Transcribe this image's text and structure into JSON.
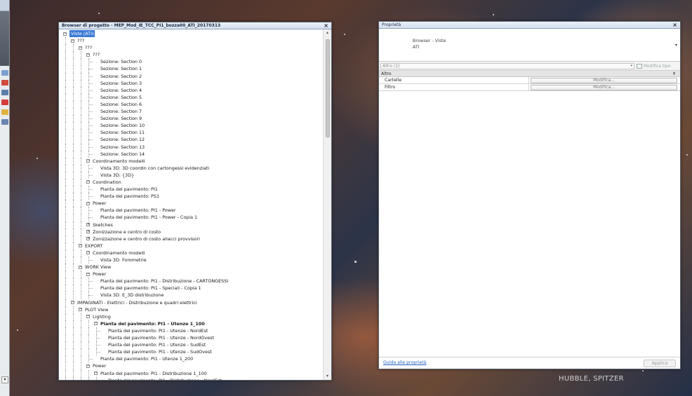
{
  "browser": {
    "title": "Browser di progetto - MEP_Mod_IE_TCC_PI1_bozza00_ATI_20170313",
    "close": "×",
    "tree": [
      {
        "level": 0,
        "exp": "−",
        "text": "Viste (ATI)",
        "selected": true
      },
      {
        "level": 1,
        "exp": "−",
        "text": "???"
      },
      {
        "level": 2,
        "exp": "−",
        "text": "???"
      },
      {
        "level": 3,
        "exp": "−",
        "text": "???"
      },
      {
        "level": 4,
        "text": "Sezione: Section 0"
      },
      {
        "level": 4,
        "text": "Sezione: Section 1"
      },
      {
        "level": 4,
        "text": "Sezione: Section 2"
      },
      {
        "level": 4,
        "text": "Sezione: Section 3"
      },
      {
        "level": 4,
        "text": "Sezione: Section 4"
      },
      {
        "level": 4,
        "text": "Sezione: Section 5"
      },
      {
        "level": 4,
        "text": "Sezione: Section 6"
      },
      {
        "level": 4,
        "text": "Sezione: Section 7"
      },
      {
        "level": 4,
        "text": "Sezione: Section 9"
      },
      {
        "level": 4,
        "text": "Sezione: Section 10"
      },
      {
        "level": 4,
        "text": "Sezione: Section 11"
      },
      {
        "level": 4,
        "text": "Sezione: Section 12"
      },
      {
        "level": 4,
        "text": "Sezione: Section 13"
      },
      {
        "level": 4,
        "text": "Sezione: Section 14"
      },
      {
        "level": 3,
        "exp": "−",
        "text": "Coordinamento modelli"
      },
      {
        "level": 4,
        "text": "Vista 3D: 3D coordin con cartongessi evidenziati"
      },
      {
        "level": 4,
        "text": "Vista 3D: {3D}"
      },
      {
        "level": 3,
        "exp": "−",
        "text": "Coordination"
      },
      {
        "level": 4,
        "text": "Pianta del pavimento: PI1"
      },
      {
        "level": 4,
        "text": "Pianta del pavimento: PS1"
      },
      {
        "level": 3,
        "exp": "−",
        "text": "Power"
      },
      {
        "level": 4,
        "text": "Pianta del pavimento: PI1 - Power"
      },
      {
        "level": 4,
        "text": "Pianta del pavimento: PI1 - Power - Copia 1"
      },
      {
        "level": 3,
        "exp": "+",
        "text": "Sketches"
      },
      {
        "level": 3,
        "exp": "+",
        "text": "Zonizzazione e centro di costo"
      },
      {
        "level": 3,
        "exp": "+",
        "text": "Zonizzazione e centro di costo allacci provvisori"
      },
      {
        "level": 2,
        "exp": "−",
        "text": "EXPORT"
      },
      {
        "level": 3,
        "exp": "−",
        "text": "Coordinamento modelli"
      },
      {
        "level": 4,
        "text": "Vista 3D: Forometrie"
      },
      {
        "level": 2,
        "exp": "−",
        "text": "WORK View"
      },
      {
        "level": 3,
        "exp": "−",
        "text": "Power"
      },
      {
        "level": 4,
        "text": "Pianta del pavimento: PI1 - Distribuzione - CARTONGESSI"
      },
      {
        "level": 4,
        "text": "Pianta del pavimento: PI1 - Speciali - Copia 1"
      },
      {
        "level": 4,
        "text": "Vista 3D: E_3D distribuzione"
      },
      {
        "level": 1,
        "exp": "−",
        "text": "IMPAGINATI - Elettrici - Distribuzione e quadri elettrici"
      },
      {
        "level": 2,
        "exp": "−",
        "text": "PLOT View"
      },
      {
        "level": 3,
        "exp": "−",
        "text": "Lighting"
      },
      {
        "level": 4,
        "exp": "−",
        "text": "Pianta del pavimento: PI1 - Utenze 1_100",
        "bold": true
      },
      {
        "level": 5,
        "text": "Pianta del pavimento: PI1 - Utenze - NordEst"
      },
      {
        "level": 5,
        "text": "Pianta del pavimento: PI1 - Utenze - NordOvest"
      },
      {
        "level": 5,
        "text": "Pianta del pavimento: PI1 - Utenze - SudEst"
      },
      {
        "level": 5,
        "text": "Pianta del pavimento: PI1 - Utenze - SudOvest"
      },
      {
        "level": 4,
        "text": "Pianta del pavimento: PI1 - Utenze 1_200"
      },
      {
        "level": 3,
        "exp": "−",
        "text": "Power"
      },
      {
        "level": 4,
        "exp": "−",
        "text": "Pianta del pavimento: PI1 - Distribuzione 1_100"
      },
      {
        "level": 5,
        "text": "Pianta del pavimento: PI1 - Distribuzione - NordEst"
      }
    ]
  },
  "properties": {
    "title": "Proprietà",
    "close": "×",
    "type_family": "Browser - Viste",
    "type_name": "ATI",
    "filter_value": "Altro (1)",
    "edit_type_label": "Modifica tipo",
    "group_label": "Altro",
    "rows": [
      {
        "name": "Cartelle",
        "value": "Modifica..."
      },
      {
        "name": "Filtro",
        "value": "Modifica..."
      }
    ],
    "help_link": "Guida alle proprietà",
    "apply_label": "Applica"
  },
  "watermark": "HUBBLE, SPITZER"
}
